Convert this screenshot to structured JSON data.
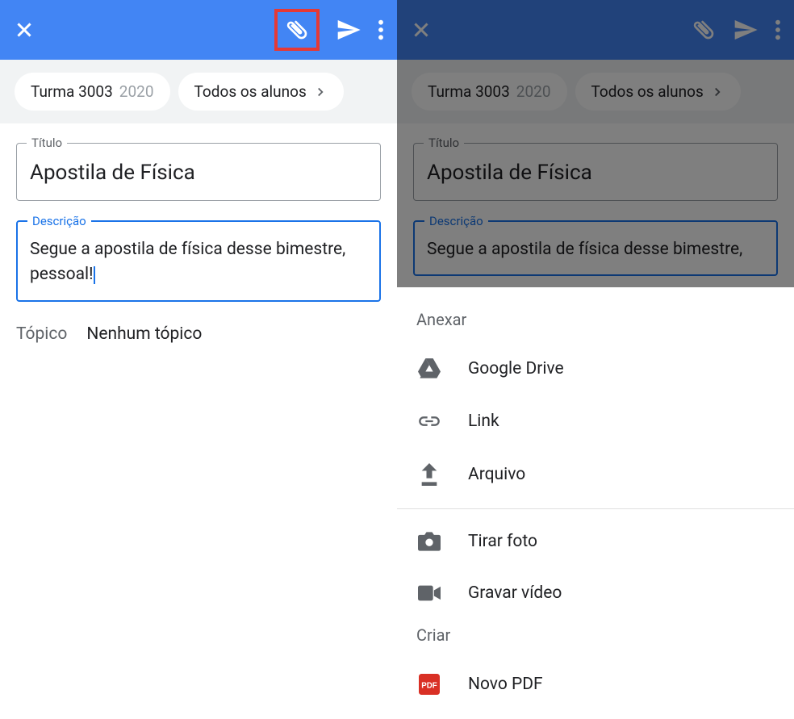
{
  "left": {
    "chips": {
      "class_name": "Turma 3003",
      "class_year": "2020",
      "audience": "Todos os alunos"
    },
    "title": {
      "label": "Título",
      "value": "Apostila de Física"
    },
    "description": {
      "label": "Descrição",
      "value": "Segue a apostila de física desse bimestre, pessoal!"
    },
    "topic": {
      "label": "Tópico",
      "value": "Nenhum tópico"
    }
  },
  "right": {
    "chips": {
      "class_name": "Turma 3003",
      "class_year": "2020",
      "audience": "Todos os alunos"
    },
    "title": {
      "label": "Título",
      "value": "Apostila de Física"
    },
    "description": {
      "label": "Descrição",
      "value": "Segue a apostila de física desse bimestre,"
    },
    "sheet": {
      "attach_header": "Anexar",
      "items_attach": [
        "Google Drive",
        "Link",
        "Arquivo"
      ],
      "items_media": [
        "Tirar foto",
        "Gravar vídeo"
      ],
      "create_header": "Criar",
      "items_create": [
        "Novo PDF"
      ]
    }
  }
}
